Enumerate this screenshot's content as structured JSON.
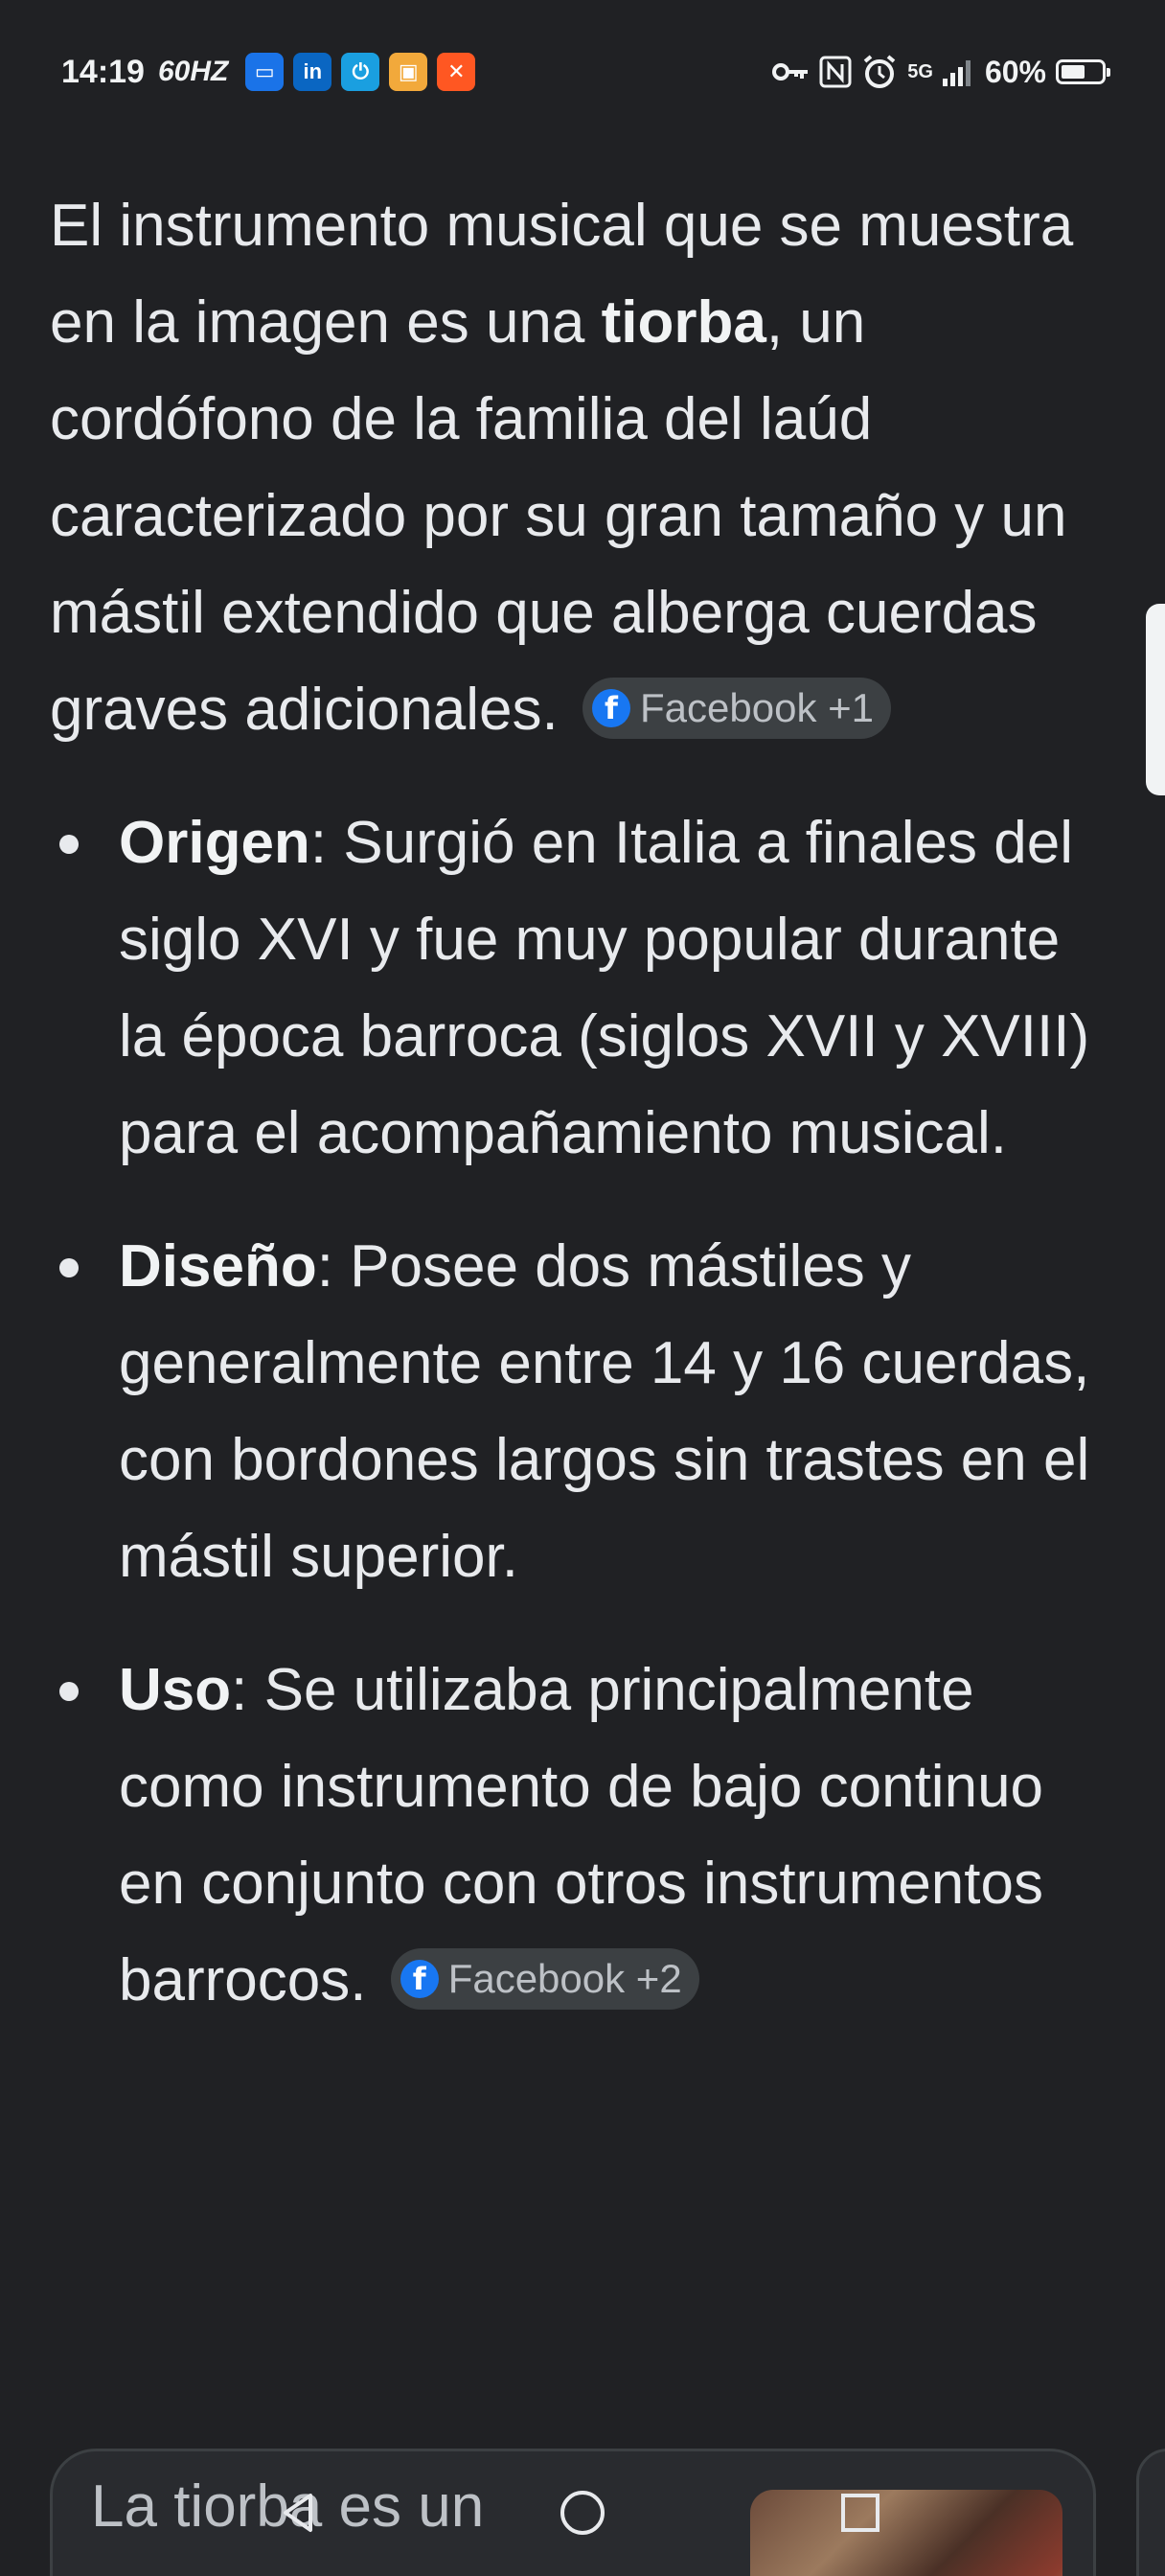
{
  "status_bar": {
    "time": "14:19",
    "refresh_rate": "60HZ",
    "app_icons": [
      {
        "name": "wallet-app-icon",
        "color": "#1a73e8",
        "glyph": "▭"
      },
      {
        "name": "linkedin-app-icon",
        "color": "#0a66c2",
        "glyph": "in"
      },
      {
        "name": "power-app-icon",
        "color": "#1a9fe0",
        "glyph": "⏻"
      },
      {
        "name": "package-app-icon",
        "color": "#f2a93b",
        "glyph": "▣"
      },
      {
        "name": "close-app-icon",
        "color": "#ff5722",
        "glyph": "✕"
      }
    ],
    "network": "5G",
    "battery_text": "60%",
    "battery_level": 0.6
  },
  "intro": {
    "before_bold": "El instrumento musical que se muestra en la imagen es una ",
    "bold": "tiorba",
    "after_bold": ", un cordófono de la familia del laúd caracterizado por su gran tamaño y un mástil extendido que alberga cuerdas graves adicionales.",
    "source_chip": "Facebook +1"
  },
  "bullets": [
    {
      "term": "Origen",
      "text": ": Surgió en Italia a finales del siglo XVI y fue muy popular durante la época barroca (siglos XVII y XVIII) para el acompañamiento musical."
    },
    {
      "term": "Diseño",
      "text": ": Posee dos mástiles y generalmente entre 14 y 16 cuerdas, con bordones largos sin trastes en el mástil superior."
    },
    {
      "term": "Uso",
      "text": ": Se utilizaba principalmente como instrumento de bajo continuo en conjunto con otros instrumentos barrocos.",
      "source_chip": "Facebook +2"
    }
  ],
  "bottom_card": {
    "text": "La tiorba es un"
  },
  "colors": {
    "background": "#202124",
    "text": "#e8eaed",
    "chip_bg": "#3c4043",
    "facebook_blue": "#1877f2"
  }
}
